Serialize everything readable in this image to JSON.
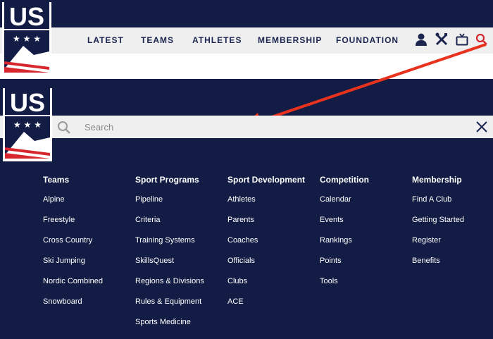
{
  "nav": {
    "links": [
      "LATEST",
      "TEAMS",
      "ATHLETES",
      "MEMBERSHIP",
      "FOUNDATION"
    ],
    "icons": [
      "user-icon",
      "tools-icon",
      "tv-icon",
      "search-icon"
    ]
  },
  "logo": {
    "text": "US"
  },
  "search": {
    "placeholder": "Search"
  },
  "colors": {
    "navy": "#131c44",
    "red": "#d7262d",
    "light_gray": "#efefef",
    "link_dark": "#1b2550"
  },
  "menu": {
    "columns": [
      {
        "title": "Teams",
        "items": [
          "Alpine",
          "Freestyle",
          "Cross Country",
          "Ski Jumping",
          "Nordic Combined",
          "Snowboard"
        ]
      },
      {
        "title": "Sport Programs",
        "items": [
          "Pipeline",
          "Criteria",
          "Training Systems",
          "SkillsQuest",
          "Regions & Divisions",
          "Rules & Equipment",
          "Sports Medicine"
        ]
      },
      {
        "title": "Sport Development",
        "items": [
          "Athletes",
          "Parents",
          "Coaches",
          "Officials",
          "Clubs",
          "ACE"
        ]
      },
      {
        "title": "Competition",
        "items": [
          "Calendar",
          "Events",
          "Rankings",
          "Points",
          "Tools"
        ]
      },
      {
        "title": "Membership",
        "items": [
          "Find A Club",
          "Getting Started",
          "Register",
          "Benefits"
        ]
      }
    ]
  }
}
